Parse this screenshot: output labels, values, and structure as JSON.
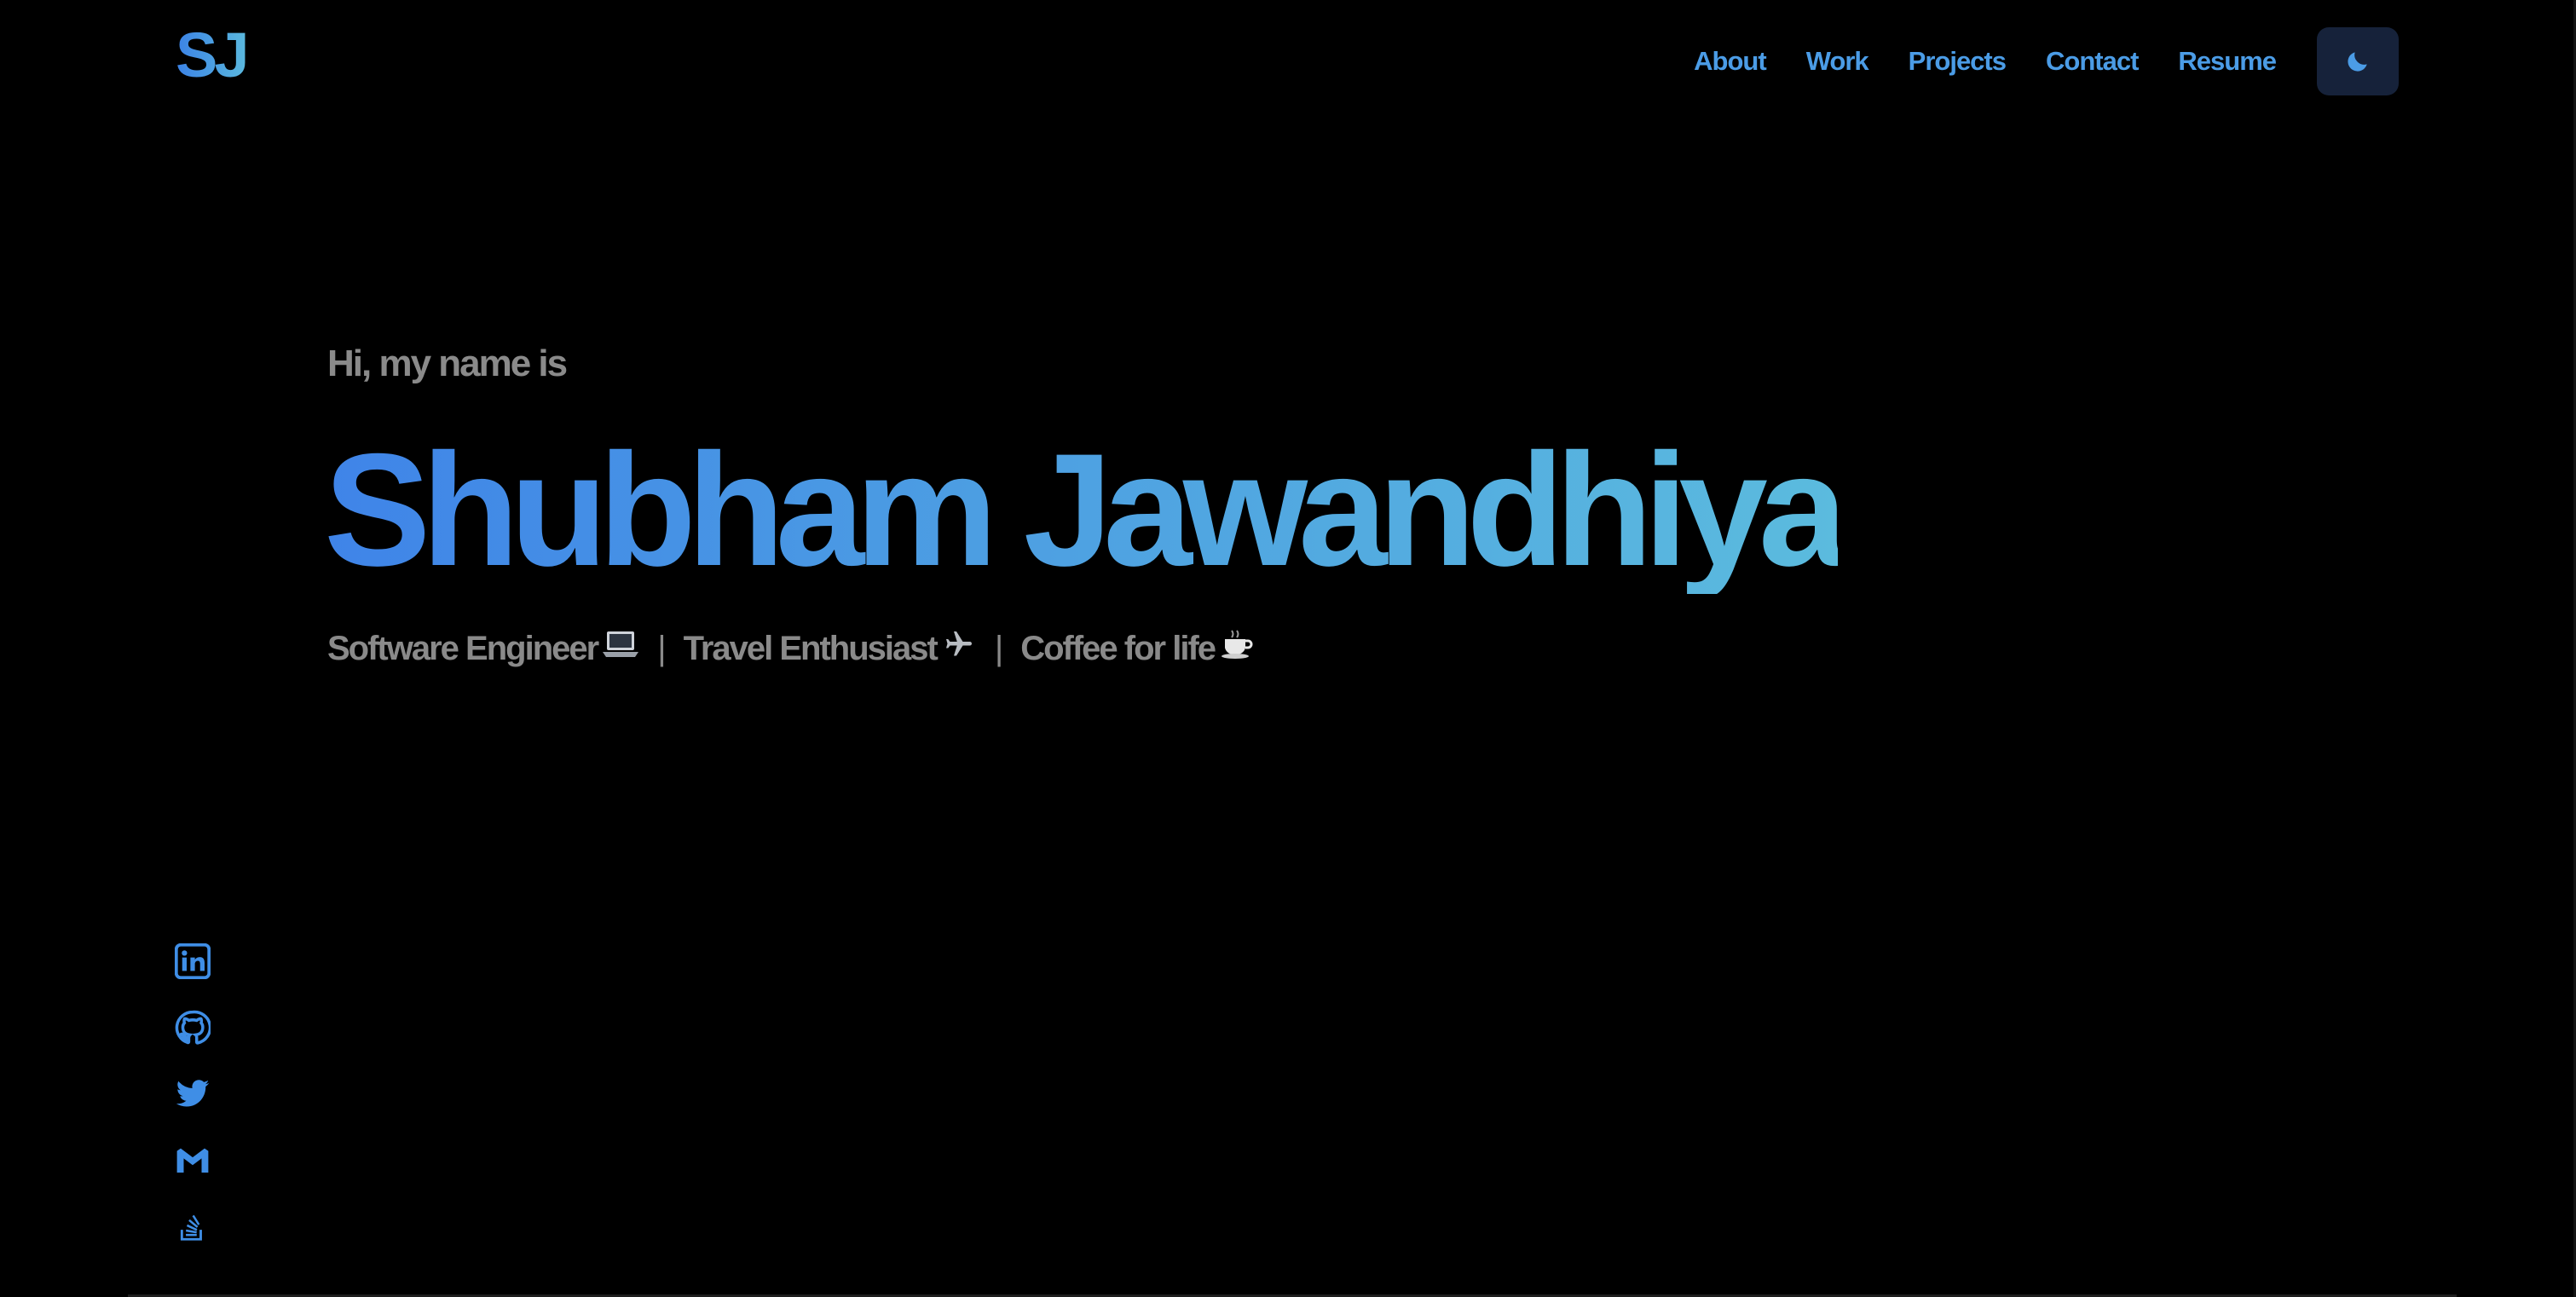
{
  "header": {
    "logo": "SJ",
    "nav": [
      "About",
      "Work",
      "Projects",
      "Contact",
      "Resume"
    ],
    "theme_toggle_icon": "moon-icon"
  },
  "hero": {
    "greeting": "Hi, my name is",
    "name": "Shubham Jawandhiya",
    "tagline": {
      "part1": "Software Engineer",
      "part2": "Travel Enthusiast",
      "part3": "Coffee for life",
      "separator": "|"
    }
  },
  "socials": [
    "linkedin-icon",
    "github-icon",
    "twitter-icon",
    "gmail-icon",
    "stackoverflow-icon"
  ],
  "colors": {
    "background": "#000000",
    "accent": "#4b9ce6",
    "gradient_start": "#3f84e8",
    "gradient_end": "#5bbbde",
    "muted_text": "#8a8a8a",
    "toggle_bg": "#16223a"
  }
}
